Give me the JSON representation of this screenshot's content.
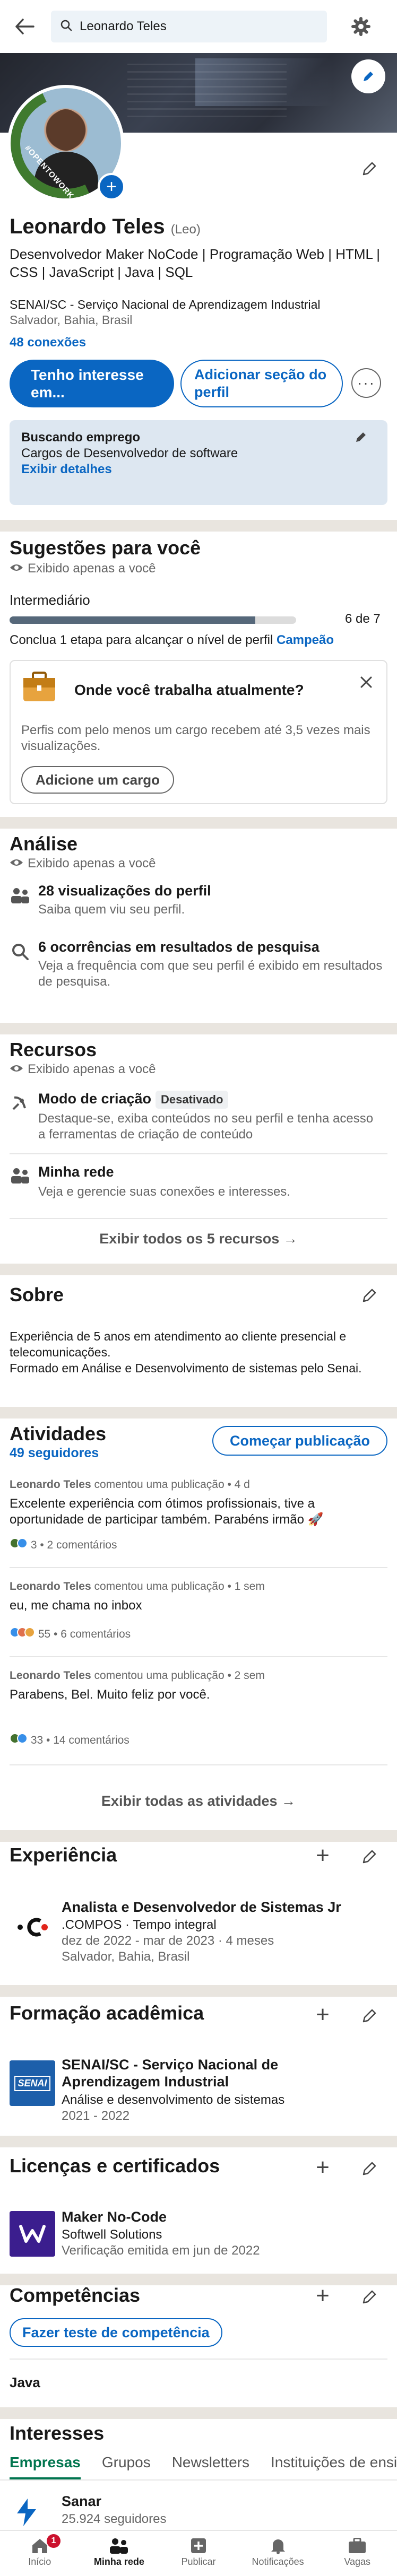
{
  "search": {
    "value": "Leonardo Teles"
  },
  "profile": {
    "name": "Leonardo Teles",
    "pronoun": "(Leo)",
    "headline": "Desenvolvedor Maker NoCode | Programação Web | HTML | CSS | JavaScript | Java | SQL",
    "organization": "SENAI/SC - Serviço Nacional de Aprendizagem Industrial",
    "location": "Salvador, Bahia, Brasil",
    "connections": "48 conexões",
    "avatar_ring_text": "#OPENTOWORK",
    "btn_interest": "Tenho interesse em...",
    "btn_add_section": "Adicionar seção do perfil",
    "btn_more": "···"
  },
  "open_to_work": {
    "title": "Buscando emprego",
    "detail": "Cargos de Desenvolvedor de software",
    "link": "Exibir detalhes"
  },
  "suggestions": {
    "title": "Sugestões para você",
    "private": "Exibido apenas a você",
    "level": "Intermediário",
    "progress_label": "6 de 7",
    "progress_fraction": 0.857,
    "hint_prefix": "Conclua 1 etapa para alcançar o nível de perfil",
    "hint_link": "Campeão",
    "card_title": "Onde você trabalha atualmente?",
    "card_body": "Perfis com pelo menos um cargo recebem até 3,5 vezes mais visualizações.",
    "card_button": "Adicione um cargo"
  },
  "analytics": {
    "title": "Análise",
    "private": "Exibido apenas a você",
    "items": [
      {
        "title": "28 visualizações do perfil",
        "desc": "Saiba quem viu seu perfil."
      },
      {
        "title": "6 ocorrências em resultados de pesquisa",
        "desc": "Veja a frequência com que seu perfil é exibido em resultados de pesquisa."
      }
    ]
  },
  "resources": {
    "title": "Recursos",
    "private": "Exibido apenas a você",
    "items": [
      {
        "title": "Modo de criação",
        "badge": "Desativado",
        "desc": "Destaque-se, exiba conteúdos no seu perfil e tenha acesso a ferramentas de criação de conteúdo"
      },
      {
        "title": "Minha rede",
        "desc": "Veja e gerencie suas conexões e interesses."
      }
    ],
    "see_all": "Exibir todos os 5 recursos →"
  },
  "about": {
    "title": "Sobre",
    "text": "Experiência de 5 anos em atendimento ao cliente presencial e telecomunicações.\nFormado em Análise e Desenvolvimento de sistemas pelo Senai."
  },
  "activity": {
    "title": "Atividades",
    "followers": "49 seguidores",
    "start_post": "Começar publicação",
    "posts": [
      {
        "author": "Leonardo Teles",
        "meta": " comentou uma publicação • 4 d",
        "text": "Excelente experiência com ótimos profissionais, tive a oportunidade de participar também. Parabéns irmão 🚀",
        "stats": "3 • 2 comentários"
      },
      {
        "author": "Leonardo Teles",
        "meta": " comentou uma publicação • 1 sem",
        "text": "eu, me chama no inbox",
        "stats": "55 • 6 comentários"
      },
      {
        "author": "Leonardo Teles",
        "meta": " comentou uma publicação • 2 sem",
        "text": "Parabens, Bel. Muito feliz por você.",
        "stats": "33 • 14 comentários"
      }
    ],
    "see_all": "Exibir todas as atividades →"
  },
  "experience": {
    "title": "Experiência",
    "role": "Analista e Desenvolvedor de Sistemas Jr",
    "company": ".COMPOS · Tempo integral",
    "dates": "dez de 2022 - mar de 2023 · 4 meses",
    "location": "Salvador, Bahia, Brasil"
  },
  "education": {
    "title": "Formação acadêmica",
    "school": "SENAI/SC - Serviço Nacional de Aprendizagem Industrial",
    "course": "Análise e desenvolvimento de sistemas",
    "years": "2021 - 2022",
    "logo_text": "SENAI"
  },
  "licenses": {
    "title": "Licenças e certificados",
    "name": "Maker No-Code",
    "issuer": "Softwell Solutions",
    "issued": "Verificação emitida em jun de 2022"
  },
  "skills": {
    "title": "Competências",
    "test_button": "Fazer teste de competência",
    "items": [
      "Java"
    ]
  },
  "interests": {
    "title": "Interesses",
    "tabs": [
      "Empresas",
      "Grupos",
      "Newsletters",
      "Instituições de ensino"
    ],
    "company_name": "Sanar",
    "company_followers": "25.924 seguidores"
  },
  "nav": {
    "items": [
      "Início",
      "Minha rede",
      "Publicar",
      "Notificações",
      "Vagas"
    ],
    "badge": "1"
  },
  "colors": {
    "primary": "#0a66c2",
    "green": "#01754f",
    "bg": "#f4f2ee"
  }
}
